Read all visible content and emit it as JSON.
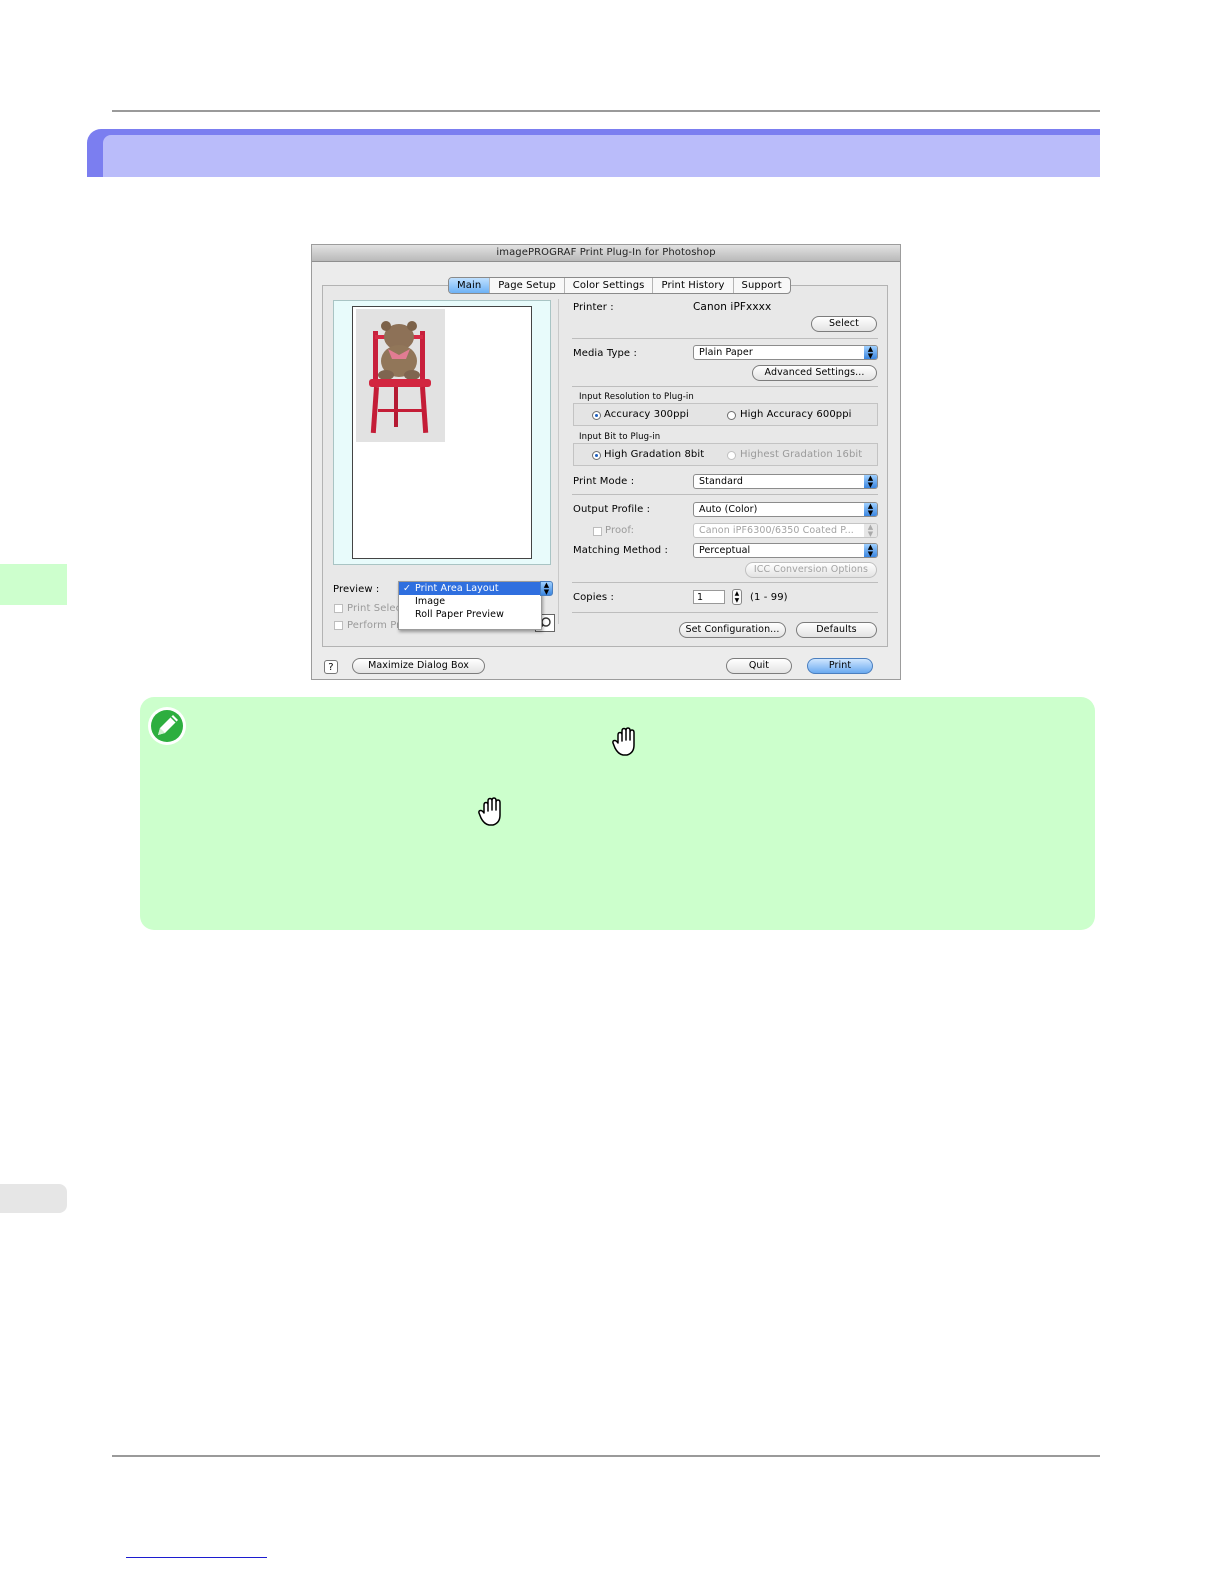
{
  "dialog": {
    "title": "imagePROGRAF Print Plug-In for Photoshop",
    "tabs": [
      "Main",
      "Page Setup",
      "Color Settings",
      "Print History",
      "Support"
    ],
    "active_tab": "Main",
    "printer": {
      "label": "Printer :",
      "value": "Canon iPFxxxx",
      "select_button": "Select"
    },
    "media_type": {
      "label": "Media Type :",
      "value": "Plain Paper",
      "advanced_button": "Advanced Settings..."
    },
    "input_resolution": {
      "title": "Input Resolution to Plug-in",
      "options": [
        "Accuracy 300ppi",
        "High Accuracy 600ppi"
      ],
      "selected": "Accuracy 300ppi"
    },
    "input_bit": {
      "title": "Input Bit to Plug-in",
      "options": [
        "High Gradation 8bit",
        "Highest Gradation 16bit"
      ],
      "selected": "High Gradation 8bit"
    },
    "print_mode": {
      "label": "Print Mode :",
      "value": "Standard"
    },
    "output_profile": {
      "label": "Output Profile :",
      "value": "Auto (Color)"
    },
    "proof": {
      "label": "Proof:",
      "value": "Canon iPF6300/6350 Coated P..."
    },
    "matching_method": {
      "label": "Matching Method :",
      "value": "Perceptual",
      "icc_button": "ICC Conversion Options"
    },
    "copies": {
      "label": "Copies :",
      "value": "1",
      "range": "(1 - 99)"
    },
    "set_configuration_button": "Set Configuration...",
    "defaults_button": "Defaults",
    "preview": {
      "label": "Preview :",
      "menu_items": [
        "Print Area Layout",
        "Image",
        "Roll Paper Preview"
      ],
      "selected": "Print Area Layout",
      "check_glyph": "✓",
      "print_selected_label": "Print Selec",
      "perform_proof_label": "Perform Proof in Preview"
    },
    "bottom": {
      "help_glyph": "?",
      "maximize_button": "Maximize Dialog Box",
      "quit_button": "Quit",
      "print_button": "Print"
    }
  },
  "icons": {
    "note": "pencil-icon",
    "hand_1": "hand-icon",
    "hand_2": "hand-icon"
  },
  "colors": {
    "section_bar": "#7b7ef0",
    "section_bar_inner": "#babcfa",
    "note_background": "#ccffcc",
    "side_tab": "#cdffcd",
    "tab_active": "#6db1f5"
  }
}
